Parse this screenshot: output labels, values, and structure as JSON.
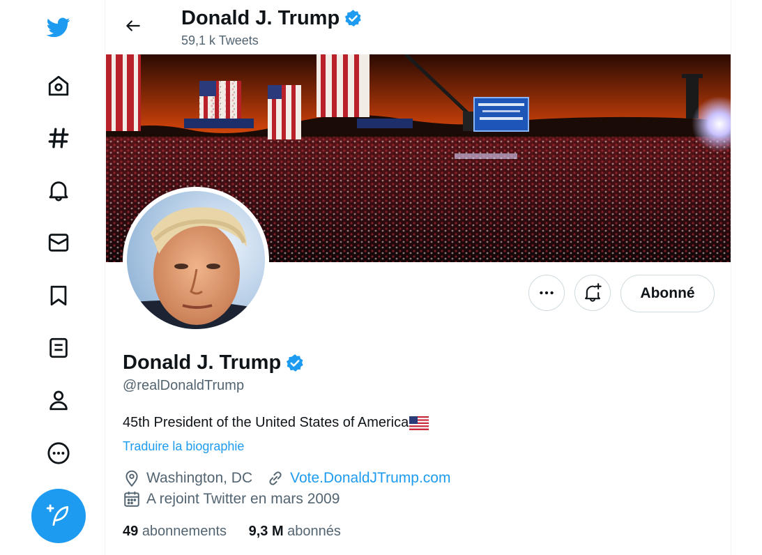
{
  "header": {
    "name": "Donald J. Trump",
    "tweet_count": "59,1 k Tweets"
  },
  "nav": {
    "items": [
      {
        "icon": "twitter-logo-icon"
      },
      {
        "icon": "home-icon"
      },
      {
        "icon": "explore-hashtag-icon"
      },
      {
        "icon": "notifications-bell-icon"
      },
      {
        "icon": "messages-envelope-icon"
      },
      {
        "icon": "bookmarks-icon"
      },
      {
        "icon": "lists-icon"
      },
      {
        "icon": "profile-icon"
      },
      {
        "icon": "more-icon"
      },
      {
        "icon": "compose-tweet-icon"
      }
    ]
  },
  "banner": {
    "sign_text": "PENNSYLVANIA WELCOMES DONALD J. TRUMP",
    "podium_text": "MAKE AMERICA GREAT AGAIN!"
  },
  "actions": {
    "more_label": "•••",
    "follow_label": "Abonné"
  },
  "profile": {
    "name": "Donald J. Trump",
    "handle": "@realDonaldTrump",
    "bio": "45th President of the United States of America",
    "translate_label": "Traduire la biographie",
    "location": "Washington, DC",
    "website": "Vote.DonaldJTrump.com",
    "joined": "A rejoint Twitter en mars 2009",
    "following_count": "49",
    "following_label": "abonnements",
    "followers_count": "9,3 M",
    "followers_label": "abonnés"
  },
  "colors": {
    "accent": "#1d9bf0",
    "text": "#0f1419",
    "secondary": "#536471",
    "border": "#cfd9de"
  }
}
